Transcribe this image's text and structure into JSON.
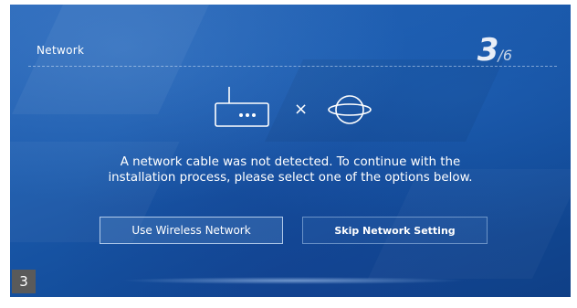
{
  "header": {
    "title": "Network",
    "step_current": "3",
    "step_total": "/6"
  },
  "icons": {
    "router": "router-icon",
    "cross": "close-icon",
    "globe": "globe-icon",
    "cross_glyph": "×"
  },
  "message": "A network cable was not detected. To continue with the installation process, please select one of the options below.",
  "buttons": {
    "wireless_label": "Use Wireless Network",
    "skip_label": "Skip Network Setting"
  },
  "page_badge": "3",
  "colors": {
    "background": "#1b5aac",
    "text": "#ffffff",
    "badge": "#5a5a5a"
  }
}
